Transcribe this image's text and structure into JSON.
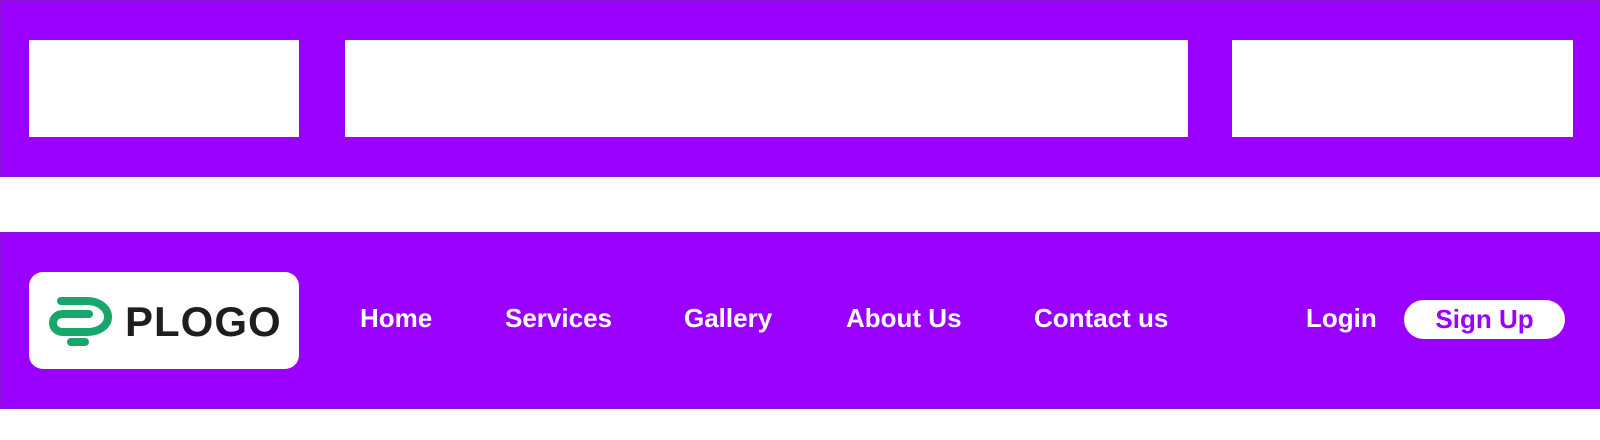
{
  "colors": {
    "primary": "#9a00ff",
    "border": "#8a10d8",
    "placeholder": "#ffffff",
    "text": "#ffffff",
    "logo_text": "#1e1e1e",
    "logo_green": "#18a66a"
  },
  "wireframe_header": {
    "blocks": [
      "logo-placeholder",
      "nav-placeholder",
      "auth-placeholder"
    ]
  },
  "header": {
    "logo": {
      "text": "PLOGO",
      "icon": "paperclip-logo-icon"
    },
    "nav": [
      {
        "label": "Home"
      },
      {
        "label": "Services"
      },
      {
        "label": "Gallery"
      },
      {
        "label": "About Us"
      },
      {
        "label": "Contact us"
      }
    ],
    "login_label": "Login",
    "signup_label": "Sign Up"
  }
}
